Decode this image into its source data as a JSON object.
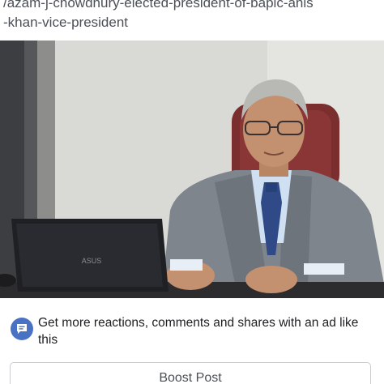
{
  "link_url": {
    "line1": "/azam-j-chowdhury-elected-president-of-bapic-anis",
    "line2": "-khan-vice-president"
  },
  "photo": {
    "laptop_brand": "ASUS"
  },
  "ad_prompt": {
    "icon": "ad-speech-bubble-icon",
    "text": "Get more reactions, comments and shares with an ad like this"
  },
  "boost_button": {
    "label": "Boost Post"
  },
  "colors": {
    "accent": "#4a72c4",
    "text_primary": "#1c1e21",
    "text_secondary": "#4b4f56",
    "border": "#c9ccd1"
  }
}
